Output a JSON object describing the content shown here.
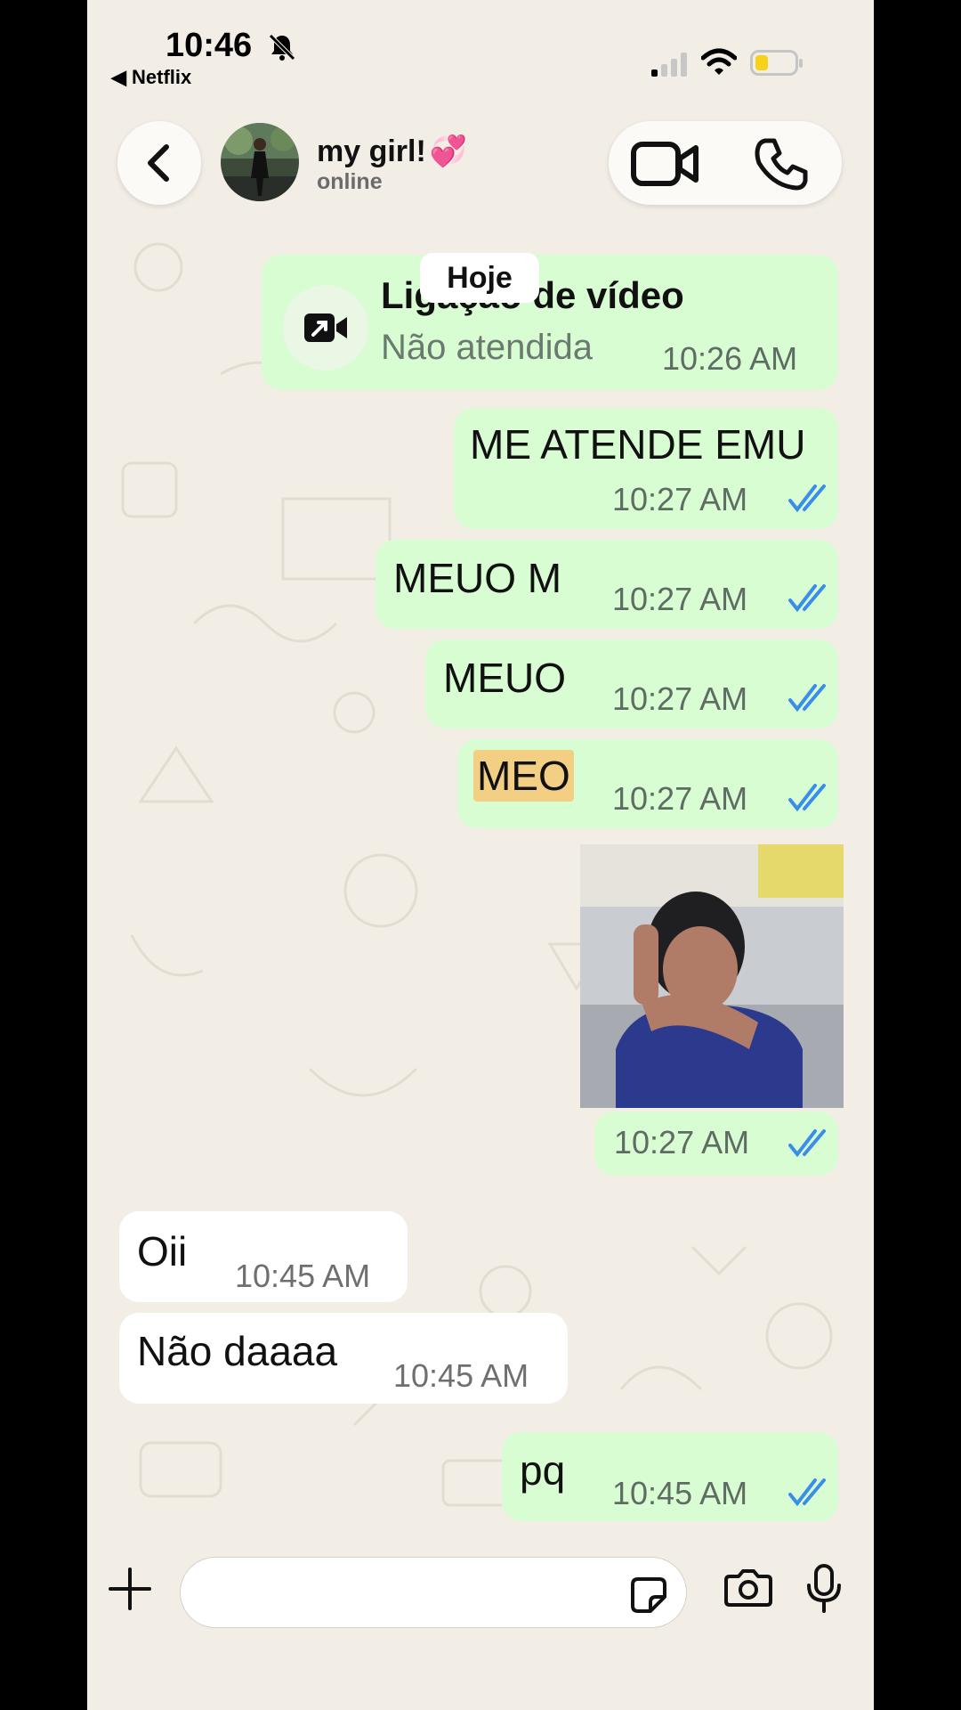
{
  "status_bar": {
    "time": "10:46",
    "back_app": "◀ Netflix"
  },
  "header": {
    "contact_name": "my girl!",
    "contact_emoji": "💞",
    "contact_status": "online"
  },
  "day_label": "Hoje",
  "call_card": {
    "title": "Ligação de vídeo",
    "subtitle": "Não atendida",
    "time": "10:26 AM"
  },
  "messages": [
    {
      "direction": "out",
      "text": "ME ATENDE EMU",
      "time": "10:27 AM",
      "read": true
    },
    {
      "direction": "out",
      "text": "MEUO M",
      "time": "10:27 AM",
      "read": true
    },
    {
      "direction": "out",
      "text": "MEUO",
      "time": "10:27 AM",
      "read": true
    },
    {
      "direction": "out",
      "text": "MEO",
      "time": "10:27 AM",
      "read": true
    },
    {
      "direction": "out",
      "type": "image",
      "time": "10:27 AM",
      "read": true
    },
    {
      "direction": "in",
      "text": "Oii",
      "time": "10:45 AM"
    },
    {
      "direction": "in",
      "text": "Não daaaa",
      "time": "10:45 AM"
    },
    {
      "direction": "out",
      "text": "pq",
      "time": "10:45 AM",
      "read": true
    }
  ],
  "composer": {
    "placeholder": ""
  },
  "colors": {
    "outgoing_bubble": "#d9fdd3",
    "incoming_bubble": "#ffffff",
    "read_ticks": "#3a8ee8",
    "highlight": "#f3cf83",
    "background": "#f2eee6"
  }
}
